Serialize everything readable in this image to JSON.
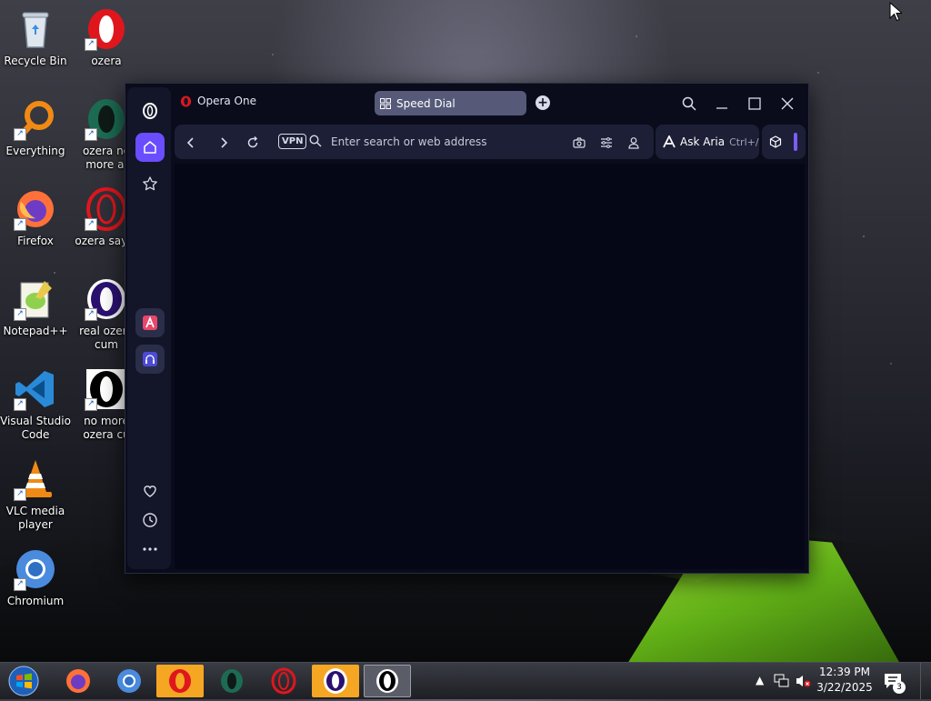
{
  "desktop": {
    "icons": [
      {
        "label": "Recycle Bin",
        "icon": "recycle-bin-icon"
      },
      {
        "label": "ozera",
        "icon": "opera-icon"
      },
      {
        "label": "Everything",
        "icon": "everything-search-icon"
      },
      {
        "label": "ozera no more ai",
        "icon": "opera-gx-icon"
      },
      {
        "label": "Firefox",
        "icon": "firefox-icon"
      },
      {
        "label": "ozera say g",
        "icon": "opera-gx-icon"
      },
      {
        "label": "Notepad++",
        "icon": "notepad-plus-plus-icon"
      },
      {
        "label": "real ozera cum",
        "icon": "opera-purple-icon"
      },
      {
        "label": "Visual Studio Code",
        "icon": "vscode-icon"
      },
      {
        "label": "no more ozera cu",
        "icon": "opera-white-icon"
      },
      {
        "label": "VLC media player",
        "icon": "vlc-icon"
      },
      {
        "label": "Chromium",
        "icon": "chromium-icon"
      }
    ]
  },
  "browser": {
    "brand": "Opera One",
    "tab_title": "Speed Dial",
    "address_placeholder": "Enter search or web address",
    "address_value": "",
    "vpn_label": "VPN",
    "aria_label": "Ask Aria",
    "aria_shortcut": "Ctrl+/",
    "accent_color": "#7b5cff"
  },
  "taskbar": {
    "time": "12:39 PM",
    "date": "3/22/2025",
    "notification_count": "3",
    "apps": [
      "firefox",
      "chromium",
      "opera",
      "opera-gx",
      "opera-gx-red",
      "opera-purple",
      "opera-white"
    ]
  }
}
